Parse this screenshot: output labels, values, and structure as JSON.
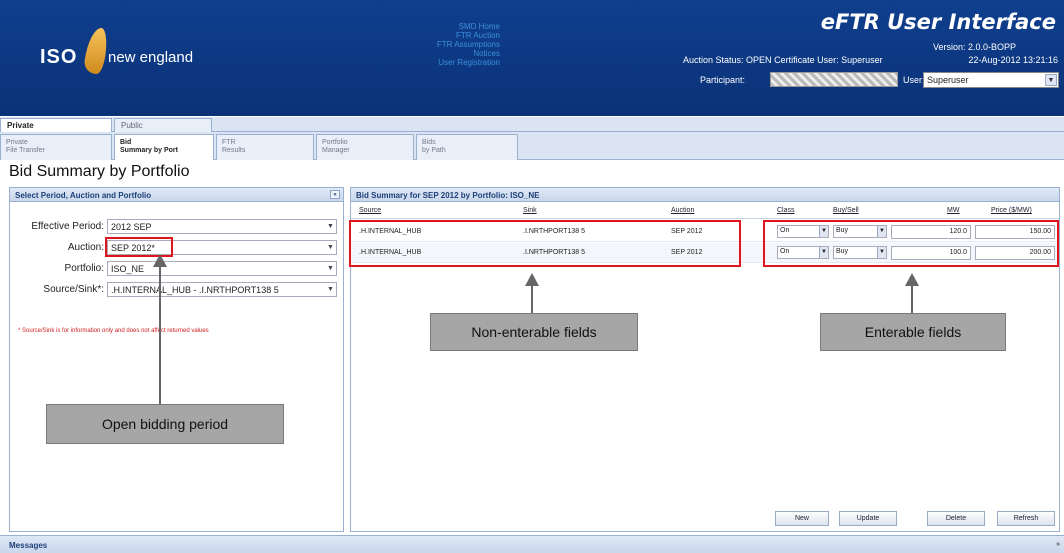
{
  "header": {
    "logo_iso": "ISO",
    "logo_ne": "new england",
    "nav_links": [
      "SMD Home",
      "FTR Auction",
      "FTR Assumptions",
      "Notices",
      "User Registration"
    ],
    "app_title": "eFTR User Interface",
    "version": "Version: 2.0.0-BOPP",
    "auction_status": "Auction Status: OPEN",
    "certificate_user": "Certificate User: Superuser",
    "datetime": "22-Aug-2012 13:21:16",
    "participant_label": "Participant:",
    "user_label": "User:",
    "user_value": "Superuser"
  },
  "tabs_top": [
    "Private",
    "Public"
  ],
  "tabs_sub": [
    {
      "line1": "Private",
      "line2": "File Transfer"
    },
    {
      "line1": "Bid",
      "line2": "Summary by Port"
    },
    {
      "line1": "FTR",
      "line2": "Results"
    },
    {
      "line1": "Portfolio",
      "line2": "Manager"
    },
    {
      "line1": "Bids",
      "line2": "by Path"
    }
  ],
  "page_title": "Bid Summary by Portfolio",
  "left_panel": {
    "title": "Select Period, Auction and Portfolio",
    "fields": [
      {
        "label": "Effective Period:",
        "value": "2012 SEP"
      },
      {
        "label": "Auction:",
        "value": "SEP 2012*"
      },
      {
        "label": "Portfolio:",
        "value": "ISO_NE"
      },
      {
        "label": "Source/Sink*:",
        "value": ".H.INTERNAL_HUB - .I.NRTHPORT138 5"
      }
    ],
    "note": "* Source/Sink is for information only and does not affect returned values"
  },
  "right_panel": {
    "title": "Bid Summary for SEP 2012 by Portfolio: ISO_NE",
    "columns": [
      "Source",
      "Sink",
      "Auction",
      "Class",
      "Buy/Sell",
      "MW",
      "Price ($/MW)"
    ],
    "rows": [
      {
        "source": ".H.INTERNAL_HUB",
        "sink": ".I.NRTHPORT138 5",
        "auction": "SEP 2012",
        "class": "On",
        "buysell": "Buy",
        "mw": "120.0",
        "price": "150.00"
      },
      {
        "source": ".H.INTERNAL_HUB",
        "sink": ".I.NRTHPORT138 5",
        "auction": "SEP 2012",
        "class": "On",
        "buysell": "Buy",
        "mw": "100.0",
        "price": "200.00"
      }
    ],
    "buttons": [
      "New",
      "Update",
      "Delete",
      "Refresh"
    ]
  },
  "annotations": {
    "non_enterable": "Non-enterable fields",
    "enterable": "Enterable fields",
    "open_bidding": "Open bidding period"
  },
  "messages": {
    "title": "Messages"
  },
  "colors": {
    "header_bg": "#0f3f8e",
    "highlight": "#e0141e",
    "callout": "#a6a6a6"
  }
}
